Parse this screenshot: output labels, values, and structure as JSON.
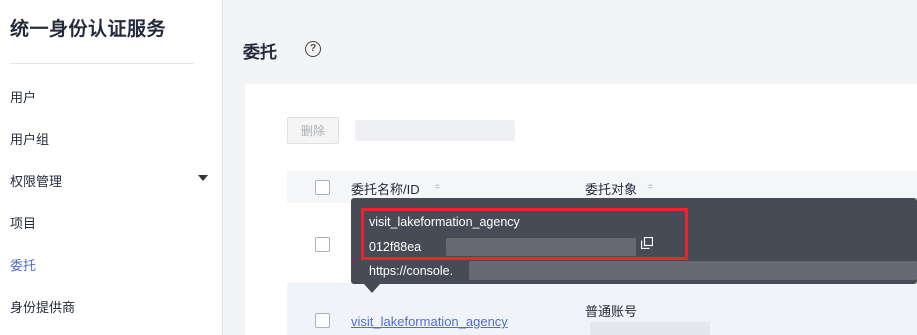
{
  "sidebar": {
    "title": "统一身份认证服务",
    "items": [
      {
        "label": "用户",
        "active": false
      },
      {
        "label": "用户组",
        "active": false
      },
      {
        "label": "权限管理",
        "active": false,
        "expandable": true
      },
      {
        "label": "项目",
        "active": false
      },
      {
        "label": "委托",
        "active": true
      },
      {
        "label": "身份提供商",
        "active": false
      }
    ]
  },
  "main": {
    "title": "委托",
    "help_icon": "?",
    "delete_button": "删除",
    "table": {
      "columns": [
        {
          "label": "委托名称/ID"
        },
        {
          "label": "委托对象"
        }
      ],
      "sort_glyph": "≑",
      "rows": [
        {
          "name": "",
          "object": ""
        },
        {
          "name": "visit_lakeformation_agency",
          "object": "普通账号"
        }
      ]
    }
  },
  "tooltip": {
    "name": "visit_lakeformation_agency",
    "id_prefix": "012f88ea",
    "url_prefix": "https://console."
  },
  "colors": {
    "accent": "#526ecc",
    "highlight": "#e8262d",
    "tooltip_bg": "#474b55"
  }
}
